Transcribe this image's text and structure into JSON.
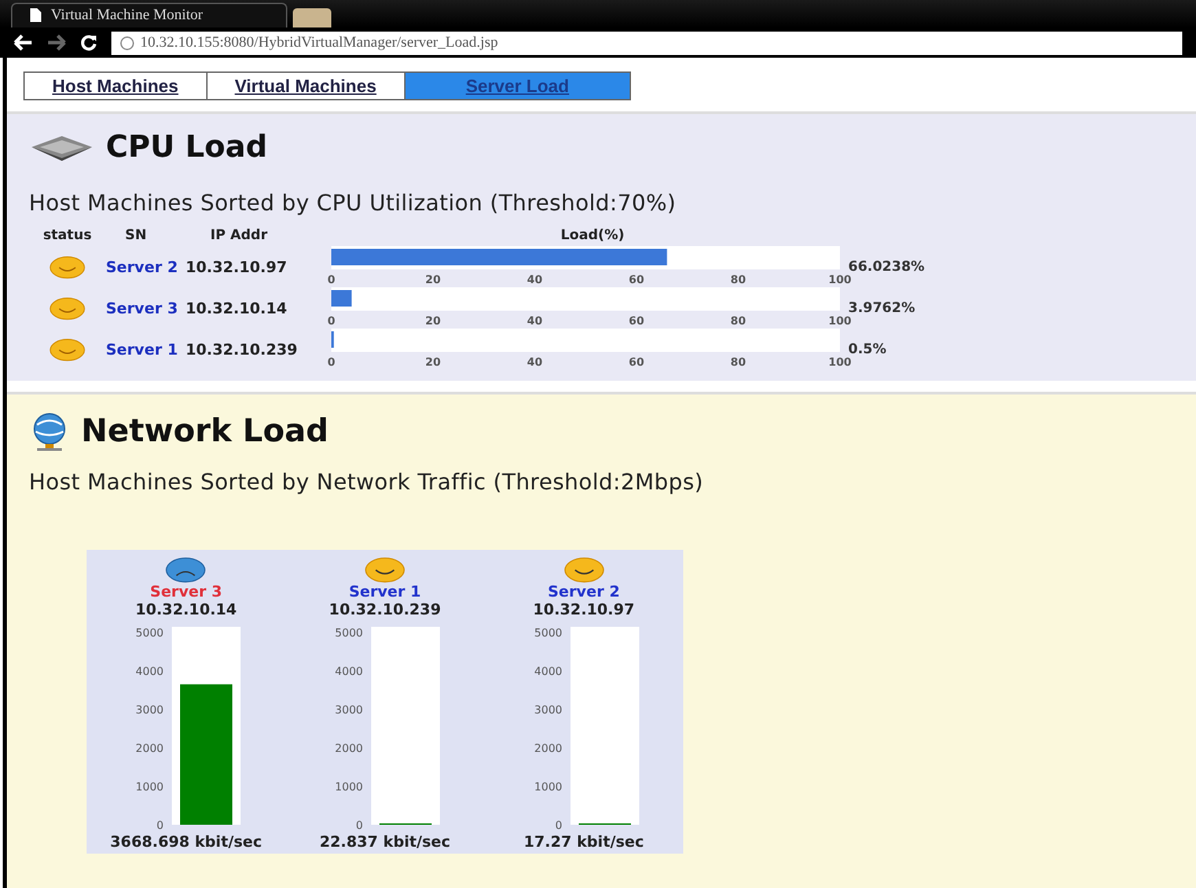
{
  "browser": {
    "tab_title": "Virtual Machine Monitor",
    "url": "10.32.10.155:8080/HybridVirtualManager/server_Load.jsp"
  },
  "nav_tabs": [
    {
      "label": "Host Machines",
      "selected": false
    },
    {
      "label": "Virtual Machines",
      "selected": false
    },
    {
      "label": "Server Load",
      "selected": true
    }
  ],
  "cpu_section": {
    "title": "CPU Load",
    "subtitle": "Host Machines Sorted by CPU Utilization (Threshold:70%)",
    "columns": [
      "status",
      "SN",
      "IP Addr",
      "Load(%)"
    ],
    "rows": [
      {
        "over_threshold": false,
        "name": "Server 2",
        "ip": "10.32.10.97",
        "level": 0.66,
        "ticks": [
          "0",
          "20",
          "40",
          "60",
          "80",
          "100"
        ],
        "reading": "66.0238%"
      },
      {
        "over_threshold": false,
        "name": "Server 3",
        "ip": "10.32.10.14",
        "level": 0.04,
        "ticks": [
          "0",
          "20",
          "40",
          "60",
          "80",
          "100"
        ],
        "reading": "3.9762%"
      },
      {
        "over_threshold": false,
        "name": "Server 1",
        "ip": "10.32.10.239",
        "level": 0.005,
        "ticks": [
          "0",
          "20",
          "40",
          "60",
          "80",
          "100"
        ],
        "reading": "0.5%"
      }
    ]
  },
  "network_section": {
    "title": "Network Load",
    "subtitle": "Host Machines Sorted by Network Traffic (Threshold:2Mbps)",
    "servers": [
      {
        "over_threshold": true,
        "name": "Server 3",
        "ip": "10.32.10.14",
        "ticks": [
          "5000",
          "4000",
          "3000",
          "2000",
          "1000",
          "0"
        ],
        "level": 0.73,
        "reading": "3668.698 kbit/sec"
      },
      {
        "over_threshold": false,
        "name": "Server 1",
        "ip": "10.32.10.239",
        "ticks": [
          "5000",
          "4000",
          "3000",
          "2000",
          "1000",
          "0"
        ],
        "level": 0.005,
        "reading": "22.837 kbit/sec"
      },
      {
        "over_threshold": false,
        "name": "Server 2",
        "ip": "10.32.10.97",
        "ticks": [
          "5000",
          "4000",
          "3000",
          "2000",
          "1000",
          "0"
        ],
        "level": 0.004,
        "reading": "17.27 kbit/sec"
      }
    ]
  }
}
